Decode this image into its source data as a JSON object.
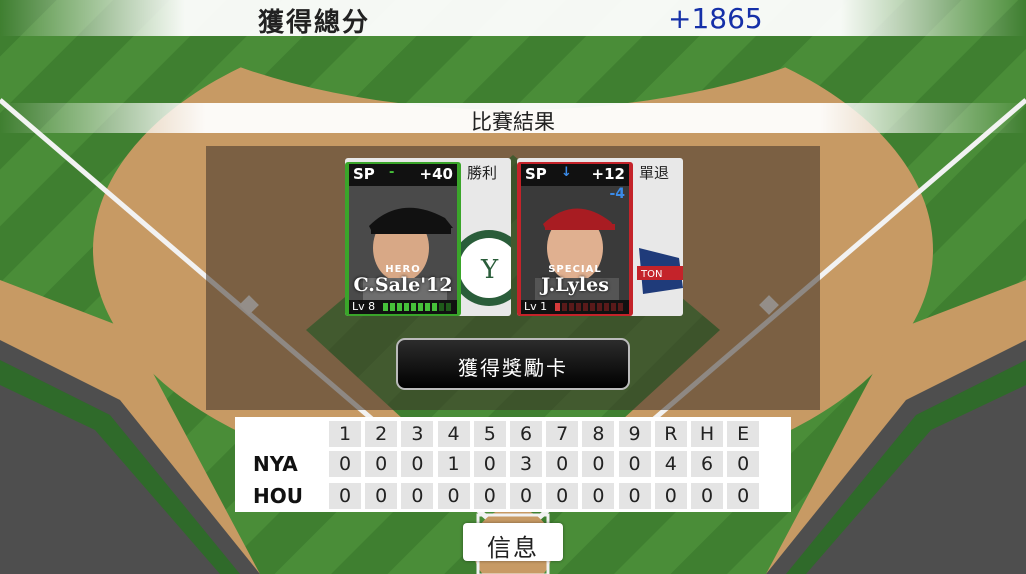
{
  "header": {
    "total_label": "獲得總分",
    "total_value": "+1865"
  },
  "result": {
    "title": "比賽結果"
  },
  "cards": [
    {
      "position": "SP",
      "arrow": "",
      "points": "+40",
      "rank": "HERO",
      "name": "C.Sale'12",
      "level": "Lv 8",
      "banner": "勝利",
      "frame_color": "#3aa52a",
      "level_fill": 8,
      "bar_color": "#46c13a"
    },
    {
      "position": "SP",
      "arrow": "↓",
      "points": "+12",
      "change": "-4",
      "rank": "SPECIAL",
      "name": "J.Lyles",
      "level": "Lv 1",
      "banner": "單退",
      "frame_color": "#c4232a",
      "level_fill": 1,
      "bar_color": "#d53a3a"
    }
  ],
  "reward_button": {
    "label": "獲得獎勵卡"
  },
  "scoreboard": {
    "headers": [
      "1",
      "2",
      "3",
      "4",
      "5",
      "6",
      "7",
      "8",
      "9",
      "R",
      "H",
      "E"
    ],
    "rows": [
      {
        "team": "NYA",
        "values": [
          "0",
          "0",
          "0",
          "1",
          "0",
          "3",
          "0",
          "0",
          "0",
          "4",
          "6",
          "0"
        ]
      },
      {
        "team": "HOU",
        "values": [
          "0",
          "0",
          "0",
          "0",
          "0",
          "0",
          "0",
          "0",
          "0",
          "0",
          "0",
          "0"
        ]
      }
    ]
  },
  "info_button": {
    "label": "信息"
  },
  "colors": {
    "grass": "#3d7a2e",
    "dirt": "#c79a64",
    "score_total": "#1530a8"
  }
}
